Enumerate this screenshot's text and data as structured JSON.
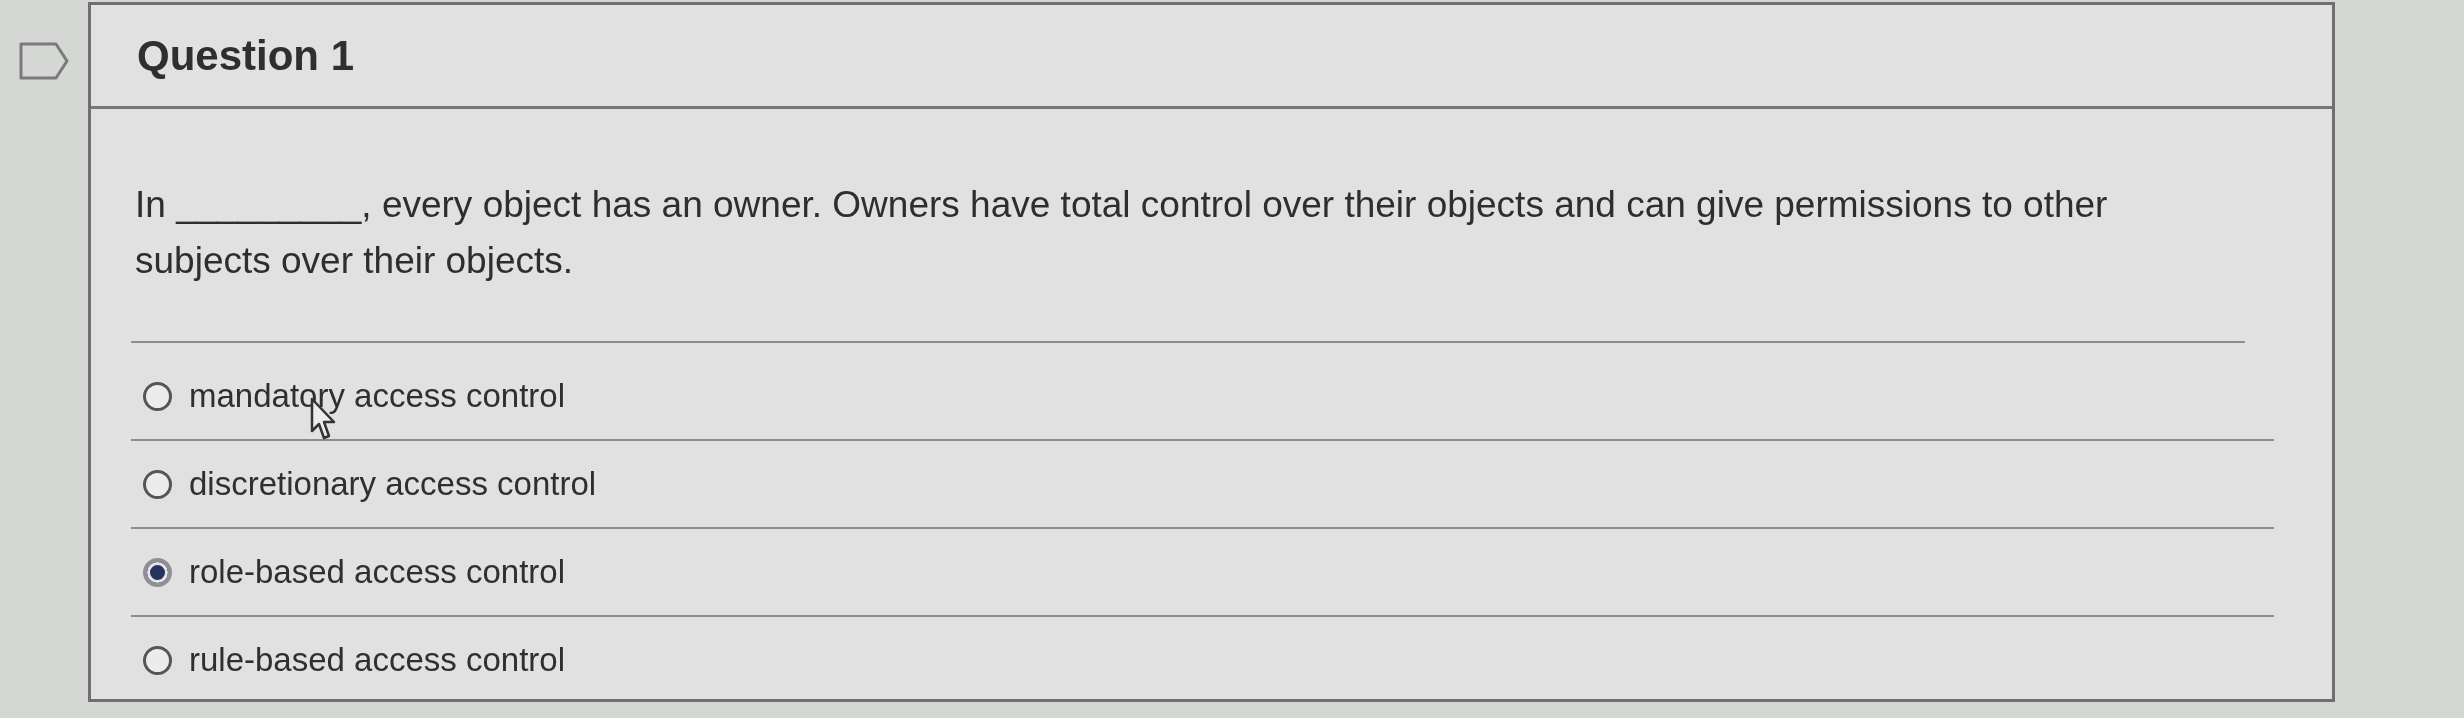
{
  "question": {
    "title": "Question 1",
    "stem": "In _________, every object has an owner. Owners have total control over their objects and can give permissions to other subjects over their objects.",
    "options": [
      {
        "label": "mandatory access control",
        "selected": false
      },
      {
        "label": "discretionary access control",
        "selected": false
      },
      {
        "label": "role-based access control",
        "selected": true
      },
      {
        "label": "rule-based access control",
        "selected": false
      }
    ]
  }
}
